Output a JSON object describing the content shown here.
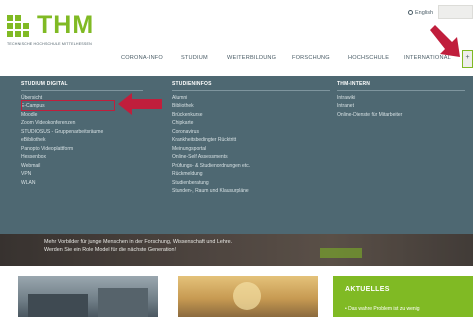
{
  "header": {
    "logo_text": "THM",
    "logo_subtitle": "TECHNISCHE HOCHSCHULE MITTELHESSEN",
    "language_link": "English",
    "menu_toggle": "+"
  },
  "main_nav": {
    "items": [
      "CORONA-INFO",
      "STUDIUM",
      "WEITERBILDUNG",
      "FORSCHUNG",
      "HOCHSCHULE",
      "INTERNATIONAL"
    ]
  },
  "mega_menu": {
    "columns": [
      {
        "heading": "STUDIUM DIGITAL",
        "links": [
          "Übersicht",
          "E-Campus",
          "Moodle",
          "Zoom Videokonferenzen",
          "STUDIOSUS - Gruppenarbeitsräume",
          "eBibliothek",
          "Panopto Videoplattform",
          "Hessenbox",
          "Webmail",
          "VPN",
          "WLAN"
        ]
      },
      {
        "heading": "STUDIENINFOS",
        "links": [
          "Alumni",
          "Bibliothek",
          "Brückenkurse",
          "Chipkarte",
          "Coronavirus",
          "Krankheitsbedingter Rücktritt",
          "Meinungsportal",
          "Online-Self Assessments",
          "Prüfungs- & Studienordnungen etc.",
          "Rückmeldung",
          "Studienberatung",
          "Stunden-, Raum und Klausurpläne"
        ]
      },
      {
        "heading": "THM-INTERN",
        "links": [
          "Intrawiki",
          "Intranet",
          "Online-Dienste für Mitarbeiter"
        ]
      }
    ]
  },
  "hero": {
    "line1": "Mehr Vorbilder für junge Menschen in der Forschung, Wissenschaft und Lehre.",
    "line2": "Werden Sie ein Role Model für die nächste Generation!"
  },
  "news": {
    "title": "AKTUELLES",
    "teaser": "• Das wahre Problem ist zu wenig"
  },
  "colors": {
    "brand_green": "#80ba24",
    "menu_bg": "#4e6872",
    "annotation_red": "#c01e3c"
  }
}
